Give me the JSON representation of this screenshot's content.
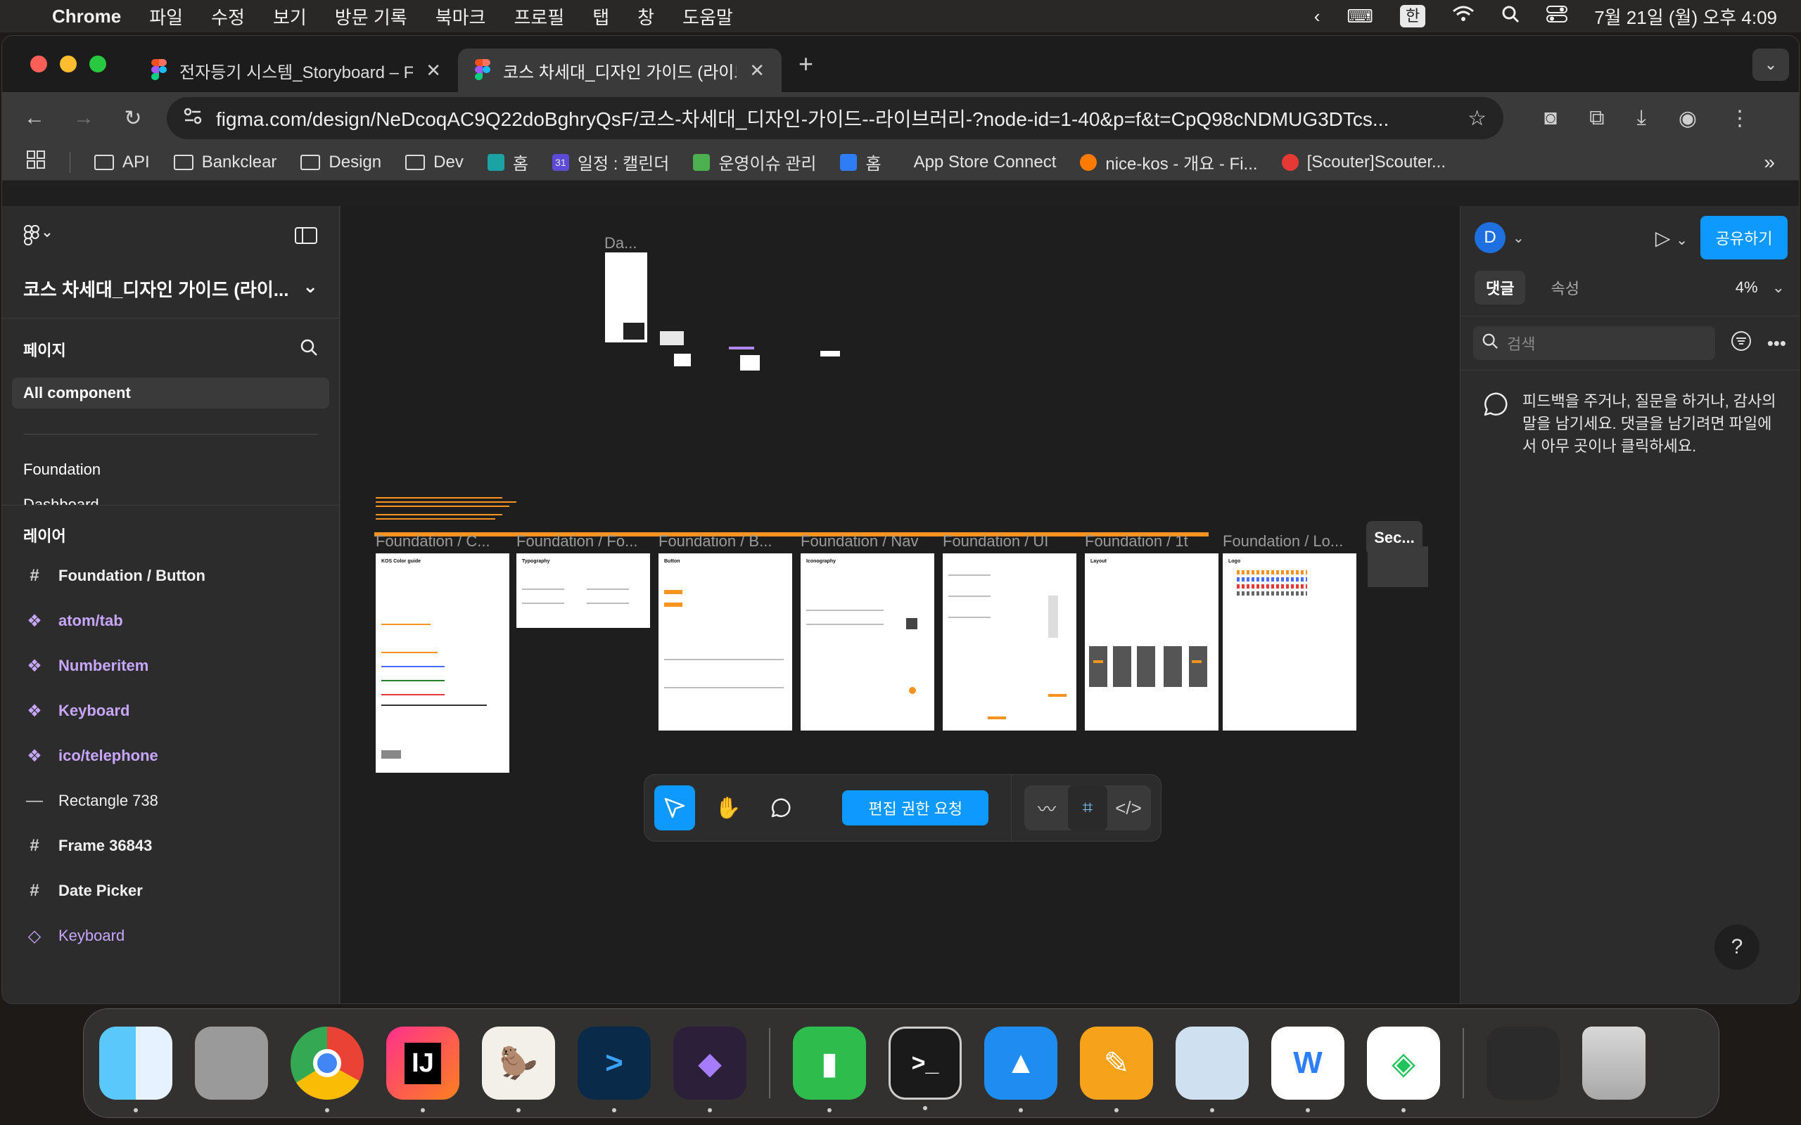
{
  "menubar": {
    "app": "Chrome",
    "items": [
      "파일",
      "수정",
      "보기",
      "방문 기록",
      "북마크",
      "프로필",
      "탭",
      "창",
      "도움말"
    ],
    "input_source": "한",
    "datetime": "7월 21일 (월) 오후 4:09"
  },
  "tabs": [
    {
      "title": "전자등기 시스템_Storyboard – F"
    },
    {
      "title": "코스 차세대_디자인 가이드 (라이브"
    }
  ],
  "omnibox": {
    "url": "figma.com/design/NeDcoqAC9Q22doBghryQsF/코스-차세대_디자인-가이드--라이브러리-?node-id=1-40&p=f&t=CpQ98cNDMUG3DTcs..."
  },
  "bookmarks": [
    "API",
    "Bankclear",
    "Design",
    "Dev",
    "홈",
    "일정 : 캘린더",
    "운영이슈 관리",
    "홈",
    "App Store Connect",
    "nice-kos - 개요 - Fi...",
    "[Scouter]Scouter..."
  ],
  "left_panel": {
    "file_name": "코스 차세대_디자인 가이드 (라이...",
    "pages_title": "페이지",
    "pages": [
      "All component",
      "Foundation",
      "Dashboard"
    ],
    "layers_title": "레이어",
    "layers": [
      {
        "name": "Foundation / Button",
        "kind": "frame"
      },
      {
        "name": "atom/tab",
        "kind": "component"
      },
      {
        "name": "Numberitem",
        "kind": "component"
      },
      {
        "name": "Keyboard",
        "kind": "component"
      },
      {
        "name": "ico/telephone",
        "kind": "component"
      },
      {
        "name": "Rectangle 738",
        "kind": "rect"
      },
      {
        "name": "Frame 36843",
        "kind": "frame"
      },
      {
        "name": "Date Picker",
        "kind": "frame"
      },
      {
        "name": "Keyboard",
        "kind": "instance"
      }
    ]
  },
  "canvas": {
    "top_label": "Da...",
    "frames": [
      {
        "label": "Foundation / C...",
        "title": "KOS Color guide"
      },
      {
        "label": "Foundation / Fo...",
        "title": "Typography"
      },
      {
        "label": "Foundation / B...",
        "title": "Button"
      },
      {
        "label": "Foundation / Nav",
        "title": "Iconography"
      },
      {
        "label": "Foundation / UI",
        "title": ""
      },
      {
        "label": "Foundation / 1t",
        "title": "Layout"
      },
      {
        "label": "Foundation / Lo...",
        "title": "Logo"
      }
    ],
    "section_label": "Sec..."
  },
  "toolbar": {
    "request_edit": "편집 권한 요청"
  },
  "right_panel": {
    "avatar_initial": "D",
    "share": "공유하기",
    "tab_comments": "댓글",
    "tab_properties": "속성",
    "zoom": "4%",
    "search_placeholder": "검색",
    "empty_message": "피드백을 주거나, 질문을 하거나, 감사의 말을 남기세요. 댓글을 남기려면 파일에서 아무 곳이나 클릭하세요.",
    "help": "?"
  },
  "dock": {
    "apps": [
      "Finder",
      "Launchpad",
      "Chrome",
      "IntelliJ IDEA",
      "DBeaver",
      "Xcode Cloud",
      "Obsidian",
      "Numbers",
      "Terminal",
      "Keynote",
      "Pages",
      "Preview",
      "Whale",
      "Naver",
      "Downloads",
      "Trash"
    ]
  }
}
